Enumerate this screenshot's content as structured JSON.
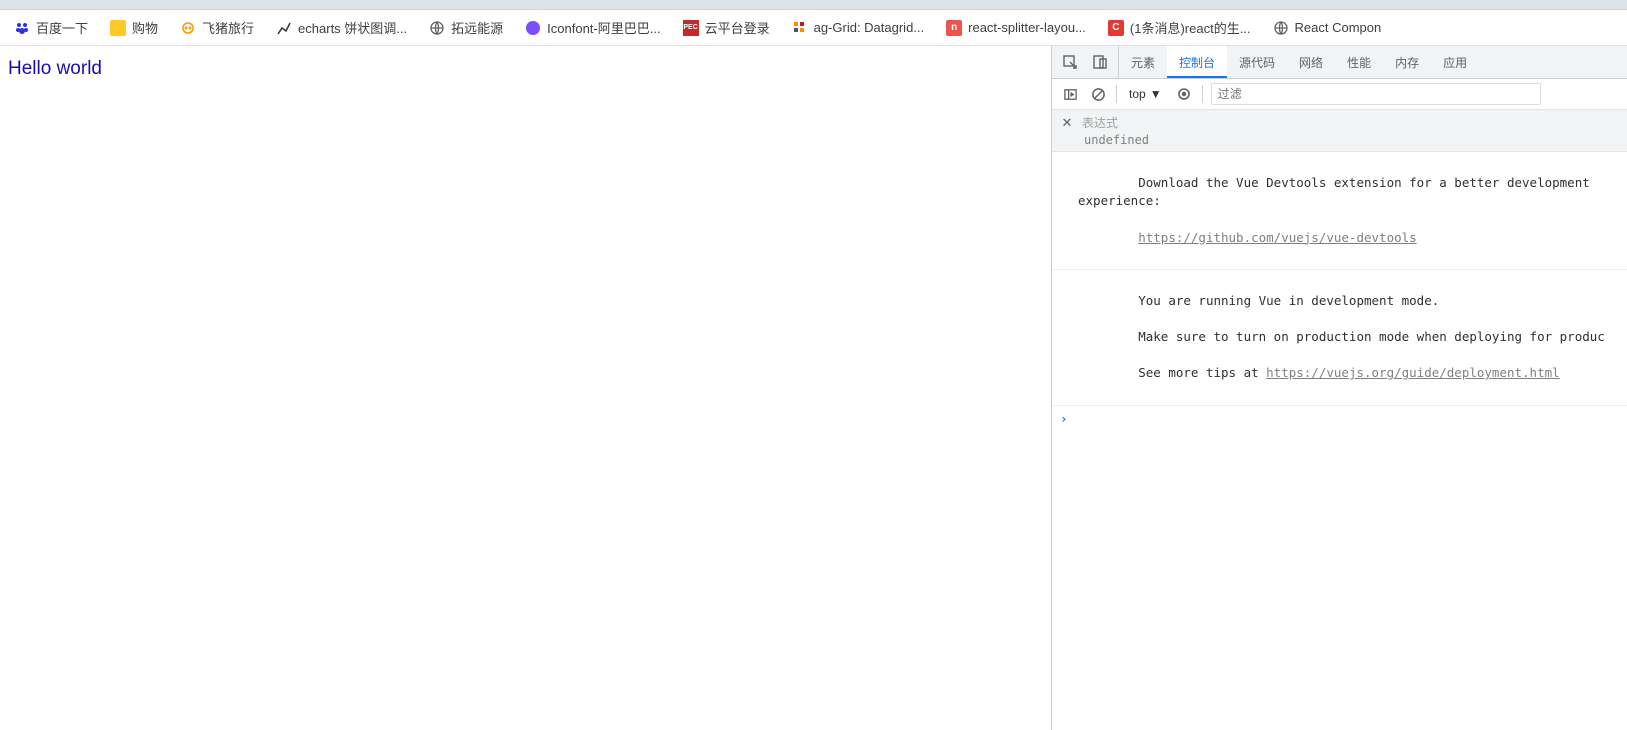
{
  "bookmarks": [
    {
      "label": "百度一下",
      "icon": "baidu"
    },
    {
      "label": "购物",
      "icon": "folder"
    },
    {
      "label": "飞猪旅行",
      "icon": "fliggy"
    },
    {
      "label": "echarts 饼状图调...",
      "icon": "echarts"
    },
    {
      "label": "拓远能源",
      "icon": "globe"
    },
    {
      "label": "Iconfont-阿里巴巴...",
      "icon": "iconfont"
    },
    {
      "label": "云平台登录",
      "icon": "pec"
    },
    {
      "label": "ag-Grid: Datagrid...",
      "icon": "aggrid"
    },
    {
      "label": "react-splitter-layou...",
      "icon": "splitter"
    },
    {
      "label": "(1条消息)react的生...",
      "icon": "csdn"
    },
    {
      "label": "React Compon",
      "icon": "globe"
    }
  ],
  "page": {
    "hello_text": "Hello world"
  },
  "devtools": {
    "tabs": {
      "elements": "元素",
      "console": "控制台",
      "sources": "源代码",
      "network": "网络",
      "performance": "性能",
      "memory": "内存",
      "application": "应用"
    },
    "toolbar": {
      "context": "top",
      "filter_placeholder": "过滤"
    },
    "expr": {
      "title": "表达式",
      "undef": "undefined"
    },
    "messages": {
      "m1_a": "Download the Vue Devtools extension for a better development experience:",
      "m1_link": "https://github.com/vuejs/vue-devtools",
      "m2_a": "You are running Vue in development mode.",
      "m2_b": "Make sure to turn on production mode when deploying for produc",
      "m2_c": "See more tips at ",
      "m2_link": "https://vuejs.org/guide/deployment.html"
    }
  }
}
